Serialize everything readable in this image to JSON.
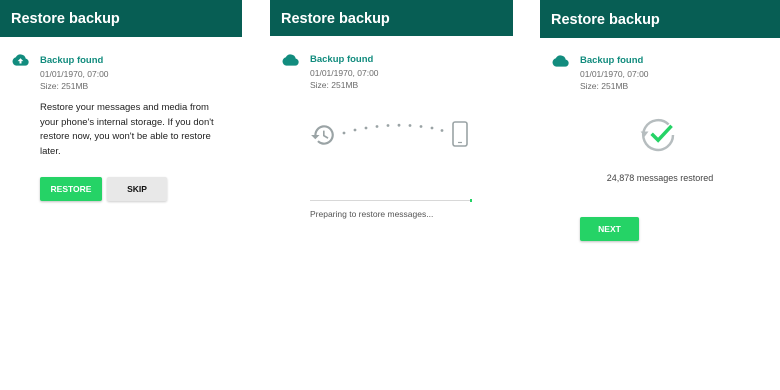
{
  "colors": {
    "header": "#075e54",
    "accent": "#128c7e",
    "button": "#25d366"
  },
  "panel1": {
    "title": "Restore backup",
    "backup_label": "Backup found",
    "date": "01/01/1970, 07:00",
    "size": "Size: 251MB",
    "description": "Restore your messages and media from your phone's internal storage. If you don't restore now, you won't be able to restore later.",
    "restore_label": "RESTORE",
    "skip_label": "SKIP",
    "icon": "cloud-upload-icon"
  },
  "panel2": {
    "title": "Restore backup",
    "backup_label": "Backup found",
    "date": "01/01/1970, 07:00",
    "size": "Size: 251MB",
    "status": "Preparing to restore messages...",
    "progress": 1.0,
    "icons": [
      "cloud-icon",
      "restore-history-icon",
      "phone-icon"
    ]
  },
  "panel3": {
    "title": "Restore backup",
    "backup_label": "Backup found",
    "date": "01/01/1970, 07:00",
    "size": "Size: 251MB",
    "restored_text": "24,878 messages restored",
    "next_label": "NEXT",
    "icons": [
      "cloud-icon",
      "restore-complete-check-icon"
    ]
  }
}
